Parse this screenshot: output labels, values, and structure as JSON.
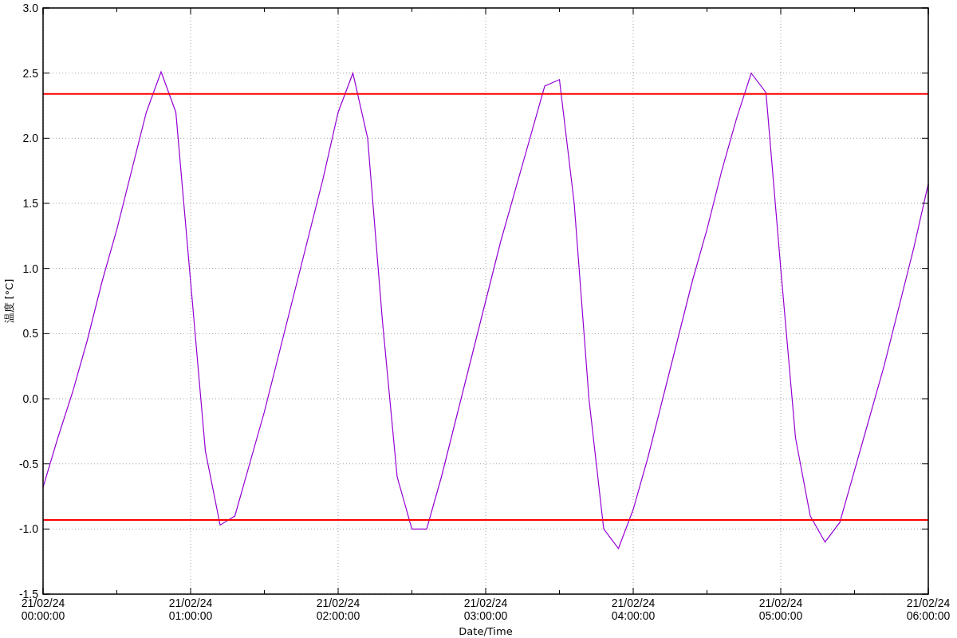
{
  "chart": {
    "chart_data": {
      "type": "line",
      "xlabel": "Date/Time",
      "ylabel": "温度 [°C]",
      "categories": [
        "21/02/24 00:00:00",
        null,
        null,
        null,
        null,
        null,
        null,
        null,
        null,
        null,
        "21/02/24 01:00:00",
        null,
        null,
        null,
        null,
        null,
        null,
        null,
        null,
        null,
        "21/02/24 02:00:00",
        null,
        null,
        null,
        null,
        null,
        null,
        null,
        null,
        null,
        "21/02/24 03:00:00",
        null,
        null,
        null,
        null,
        null,
        null,
        null,
        null,
        null,
        "21/02/24 04:00:00",
        null,
        null,
        null,
        null,
        null,
        null,
        null,
        null,
        null,
        "21/02/24 05:00:00",
        null,
        null,
        null,
        null,
        null,
        null,
        null,
        null,
        null,
        "21/02/24 06:00:00"
      ],
      "series": [
        {
          "color": "#9400d3",
          "values": [
            -0.68,
            -0.3,
            0.05,
            0.45,
            0.9,
            1.3,
            1.75,
            2.2,
            2.51,
            2.2,
            0.9,
            -0.4,
            -0.97,
            -0.9,
            -0.5,
            -0.1,
            0.35,
            0.8,
            1.25,
            1.7,
            2.2,
            2.5,
            2.0,
            0.6,
            -0.6,
            -1.0,
            -1.0,
            -0.6,
            -0.15,
            0.3,
            0.75,
            1.2,
            1.6,
            2.0,
            2.4,
            2.45,
            1.5,
            0.0,
            -1.0,
            -1.15,
            -0.85,
            -0.45,
            0.0,
            0.45,
            0.9,
            1.3,
            1.75,
            2.15,
            2.5,
            2.35,
            1.0,
            -0.3,
            -0.9,
            -1.1,
            -0.95,
            -0.55,
            -0.15,
            0.25,
            0.7,
            1.15,
            1.65
          ]
        }
      ],
      "ylim": [
        -1.5,
        3.0
      ],
      "yticks": [
        {
          "value": -1.5,
          "label": "-1.5"
        },
        {
          "value": -1.0,
          "label": "-1.0"
        },
        {
          "value": -0.5,
          "label": "-0.5"
        },
        {
          "value": 0,
          "label": "0.0"
        },
        {
          "value": 0.5,
          "label": "0.5"
        },
        {
          "value": 1.0,
          "label": "1.0"
        },
        {
          "value": 1.5,
          "label": "1.5"
        },
        {
          "value": 2.0,
          "label": "2.0"
        },
        {
          "value": 2.5,
          "label": "2.5"
        },
        {
          "value": 3.0,
          "label": "3.0"
        }
      ],
      "grid": true,
      "ref_lines": [
        {
          "axis": "y",
          "value": 2.34,
          "color": "#ff0000"
        },
        {
          "axis": "y",
          "value": -0.93,
          "color": "#ff0000"
        }
      ]
    }
  }
}
